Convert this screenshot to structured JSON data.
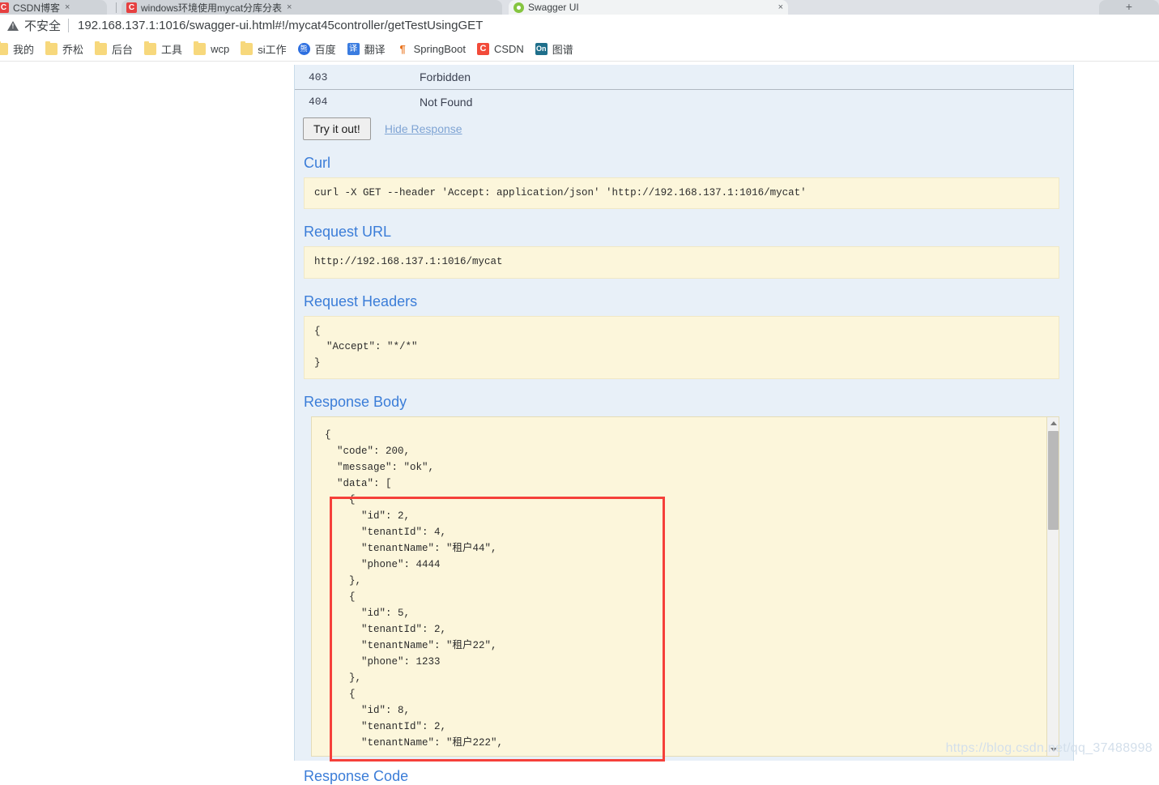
{
  "browser": {
    "tabs": [
      {
        "title": "CSDN博客",
        "favicon": "csdn-icon",
        "active": false,
        "close_label": "×"
      },
      {
        "title": "windows环境使用mycat分库分表",
        "favicon": "csdn-icon",
        "active": false,
        "close_label": "×"
      },
      {
        "title": "Swagger UI",
        "favicon": "swagger-icon",
        "active": true,
        "close_label": "×"
      }
    ],
    "new_tab_label": "+",
    "omnibox": {
      "security_label": "不安全",
      "security_icon": "warning-triangle-icon",
      "url": "192.168.137.1:1016/swagger-ui.html#!/mycat45controller/getTestUsingGET"
    },
    "bookmarks": [
      {
        "label": "我的",
        "icon": "folder-icon"
      },
      {
        "label": "乔松",
        "icon": "folder-icon"
      },
      {
        "label": "后台",
        "icon": "folder-icon"
      },
      {
        "label": "工具",
        "icon": "folder-icon"
      },
      {
        "label": "wcp",
        "icon": "folder-icon"
      },
      {
        "label": "si工作",
        "icon": "folder-icon"
      },
      {
        "label": "百度",
        "icon": "baidu-icon",
        "icon_text": "熊"
      },
      {
        "label": "翻译",
        "icon": "translate-icon",
        "icon_text": "译"
      },
      {
        "label": "SpringBoot",
        "icon": "springboot-icon",
        "icon_text": "¶"
      },
      {
        "label": "CSDN",
        "icon": "csdn-icon",
        "icon_text": "C"
      },
      {
        "label": "图谱",
        "icon": "on-icon",
        "icon_text": "On"
      }
    ]
  },
  "swagger": {
    "response_statuses": [
      {
        "code": "403",
        "message": "Forbidden"
      },
      {
        "code": "404",
        "message": "Not Found"
      }
    ],
    "try_it_out_label": "Try it out!",
    "hide_response_label": "Hide Response",
    "sections": {
      "curl_title": "Curl",
      "curl_value": "curl -X GET --header 'Accept: application/json' 'http://192.168.137.1:1016/mycat'",
      "request_url_title": "Request URL",
      "request_url_value": "http://192.168.137.1:1016/mycat",
      "request_headers_title": "Request Headers",
      "request_headers_value": "{\n  \"Accept\": \"*/*\"\n}",
      "response_body_title": "Response Body",
      "response_code_title": "Response Code"
    },
    "response_body": {
      "code": 200,
      "message": "ok",
      "data": [
        {
          "id": 2,
          "tenantId": 4,
          "tenantName": "租户44",
          "phone": 4444
        },
        {
          "id": 5,
          "tenantId": 2,
          "tenantName": "租户22",
          "phone": 1233
        },
        {
          "id": 8,
          "tenantId": 2,
          "tenantName": "租户222",
          "phone": null
        }
      ],
      "raw_text": "{\n  \"code\": 200,\n  \"message\": \"ok\",\n  \"data\": [\n    {\n      \"id\": 2,\n      \"tenantId\": 4,\n      \"tenantName\": \"租户44\",\n      \"phone\": 4444\n    },\n    {\n      \"id\": 5,\n      \"tenantId\": 2,\n      \"tenantName\": \"租户22\",\n      \"phone\": 1233\n    },\n    {\n      \"id\": 8,\n      \"tenantId\": 2,\n      \"tenantName\": \"租户222\","
    },
    "annotation": {
      "shape": "rectangle",
      "color": "#f5403a"
    },
    "scrollbar": {
      "up_arrow": "scroll-up-arrow-icon",
      "down_arrow": "scroll-down-arrow-icon"
    }
  },
  "watermark": "https://blog.csdn.net/qq_37488998"
}
